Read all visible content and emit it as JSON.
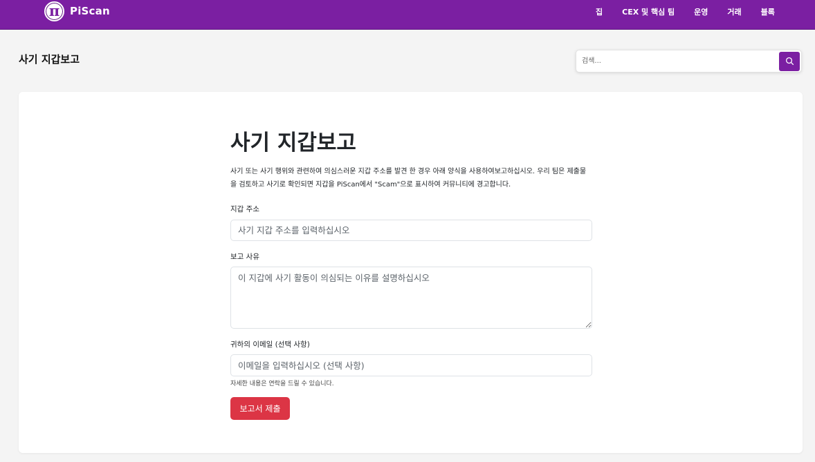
{
  "navbar": {
    "brand_symbol": "π",
    "brand_name": "PiScan",
    "links": [
      "집",
      "CEX 및 핵심 팀",
      "운영",
      "거래",
      "블록"
    ],
    "bg_color": "#7b1fa2"
  },
  "header": {
    "title": "사기 지갑보고",
    "search": {
      "placeholder": "검색...",
      "button_icon": "search-icon"
    }
  },
  "form": {
    "title": "사기 지갑보고",
    "description": "사기 또는 사기 행위와 관련하여 의심스러운 지갑 주소를 발견 한 경우 아래 양식을 사용하여보고하십시오. 우리 팀은 제출물을 검토하고 사기로 확인되면 지갑을 PiScan에서 \"Scam\"으로 표시하여 커뮤니티에 경고합니다.",
    "address_label": "지갑 주소",
    "address_placeholder": "사기 지갑 주소를 입력하십시오",
    "reason_label": "보고 사유",
    "reason_placeholder": "이 지갑에 사기 활동이 의심되는 이유를 설명하십시오",
    "email_label": "귀하의 이메일 (선택 사항)",
    "email_placeholder": "이메일을 입력하십시오 (선택 사항)",
    "email_help": "자세한 내용은 연락을 드릴 수 있습니다.",
    "submit_label": "보고서 제출",
    "submit_color": "#dc3545"
  }
}
